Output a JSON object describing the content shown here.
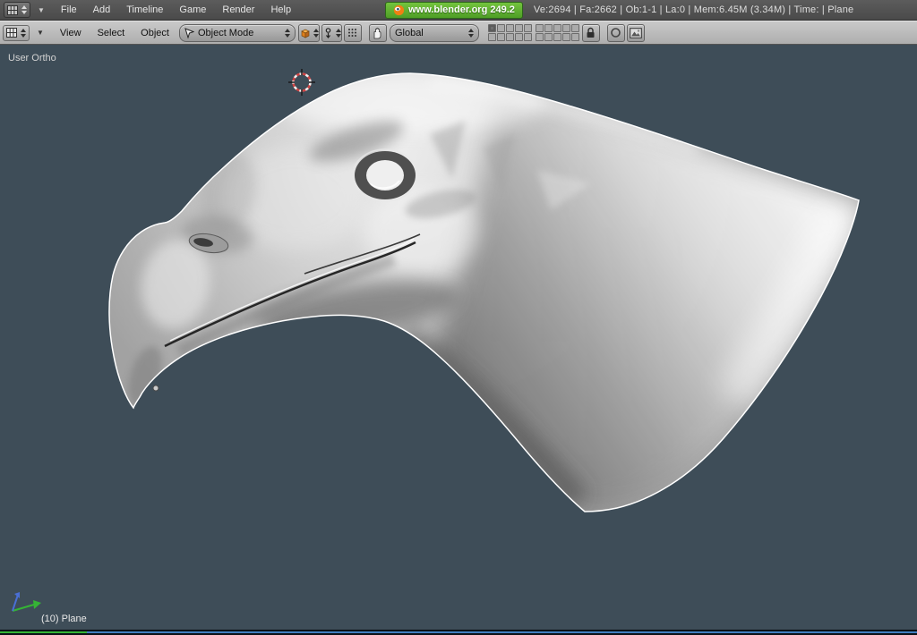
{
  "top_bar": {
    "menus": [
      {
        "label": "File"
      },
      {
        "label": "Add"
      },
      {
        "label": "Timeline"
      },
      {
        "label": "Game"
      },
      {
        "label": "Render"
      },
      {
        "label": "Help"
      }
    ],
    "badge_label": "www.blender.org 249.2",
    "stats": "Ve:2694 | Fa:2662 | Ob:1-1 | La:0  | Mem:6.45M (3.34M) | Time: | Plane"
  },
  "viewport_header": {
    "menus": [
      {
        "label": "View"
      },
      {
        "label": "Select"
      },
      {
        "label": "Object"
      }
    ],
    "mode_dropdown": {
      "value": "Object Mode"
    },
    "orientation_dropdown": {
      "value": "Global"
    },
    "layers": {
      "blocks": [
        {
          "count": 10,
          "active": [
            0
          ]
        },
        {
          "count": 10,
          "active": []
        }
      ]
    }
  },
  "viewport": {
    "view_mode_label": "User Ortho",
    "active_object_label": "(10) Plane"
  },
  "icons": {
    "collapse_arrow": "▼"
  },
  "colors": {
    "badge_green": "#4f9e26",
    "top_bar_bg": "#5c5c5c",
    "header_bg": "#aeaeae",
    "viewport_bg": "#3e4d58",
    "selection_outline": "#ffffff",
    "cursor_red": "#cf4444",
    "axis_green": "#35b435",
    "axis_blue": "#4a6fd4"
  }
}
